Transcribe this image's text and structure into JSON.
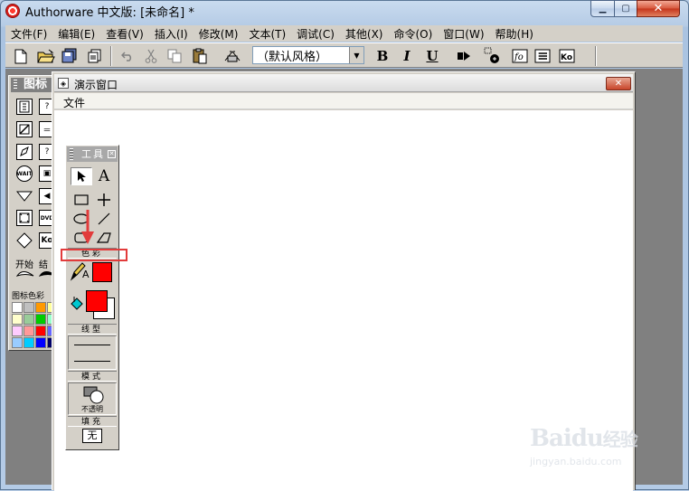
{
  "window": {
    "title": "Authorware 中文版: [未命名] *",
    "min_glyph": "▁",
    "max_glyph": "▢",
    "close_glyph": "✕"
  },
  "menubar": {
    "items": [
      "文件(F)",
      "编辑(E)",
      "查看(V)",
      "插入(I)",
      "修改(M)",
      "文本(T)",
      "调试(C)",
      "其他(X)",
      "命令(O)",
      "窗口(W)",
      "帮助(H)"
    ]
  },
  "toolbar": {
    "style_value": "（默认风格）",
    "bold": "B",
    "italic": "I",
    "underline": "U",
    "fn_label": "fo",
    "ko_label": "Ko"
  },
  "icon_palette": {
    "title": "图标",
    "start_label": "开始",
    "end_label": "结",
    "color_label": "图标色彩",
    "wait_label": "WAIT",
    "ko_label": "Ko",
    "dvd_label": "DVD",
    "colors": [
      "#ffffff",
      "#c0c0c0",
      "#ff9900",
      "#ffff99",
      "#ffffcc",
      "#99cc99",
      "#00cc00",
      "#99ffcc",
      "#ffccff",
      "#ff9999",
      "#ff0000",
      "#6666ff",
      "#99ccff",
      "#00ccff",
      "#0000ff",
      "#000066"
    ]
  },
  "presentation": {
    "title": "演示窗口",
    "menu_file": "文件",
    "close_glyph": "✕"
  },
  "tools": {
    "title": "工具",
    "close_glyph": "✕",
    "text_tool": "A",
    "color_section": "色彩",
    "text_color_letter": "A",
    "line_section": "线型",
    "mode_section": "模式",
    "mode_value": "不透明",
    "fill_section": "填充",
    "fill_value": "无",
    "pen_color": "#ff0000",
    "fill_fg_color": "#ff0000",
    "fill_bg_color": "#ffffff"
  },
  "watermark": {
    "brand": "Baidu",
    "brand_cn": "经验",
    "url": "jingyan.baidu.com"
  }
}
